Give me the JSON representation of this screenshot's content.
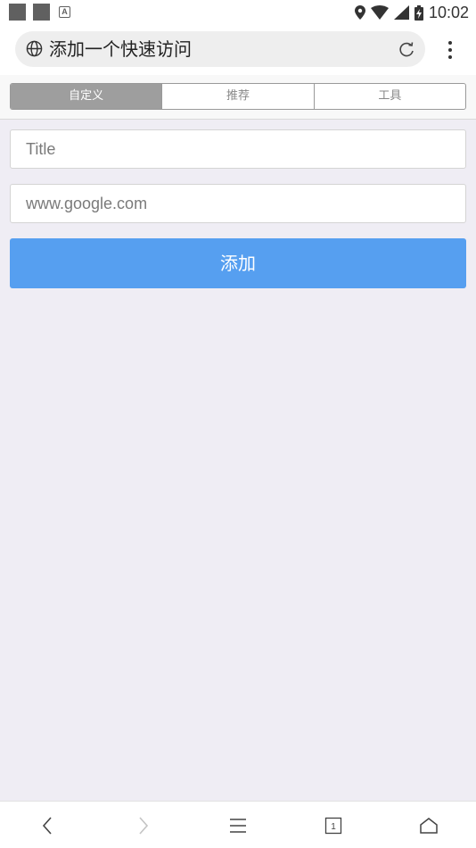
{
  "status_bar": {
    "time": "10:02",
    "notification_icons": [
      "square-icon",
      "square-icon",
      "a-icon"
    ],
    "a_icon_glyph": "A",
    "system_icons": [
      "location-icon",
      "wifi-icon",
      "signal-icon",
      "battery-charging-icon"
    ]
  },
  "address_bar": {
    "title": "添加一个快速访问",
    "site_icon": "globe-icon",
    "actions": [
      "reload-icon",
      "menu-dots-icon"
    ]
  },
  "tabs": {
    "items": [
      {
        "label": "自定义",
        "active": true
      },
      {
        "label": "推荐",
        "active": false
      },
      {
        "label": "工具",
        "active": false
      }
    ]
  },
  "form": {
    "title_placeholder": "Title",
    "title_value": "",
    "url_placeholder": "www.google.com",
    "url_value": "",
    "add_button_label": "添加"
  },
  "bottom_nav": {
    "items": [
      "back-icon",
      "forward-icon",
      "menu-icon",
      "tabs-icon",
      "home-icon"
    ],
    "tab_count": "1"
  },
  "colors": {
    "background": "#efedf4",
    "accent": "#569ff0",
    "active_tab": "#9e9e9e"
  }
}
